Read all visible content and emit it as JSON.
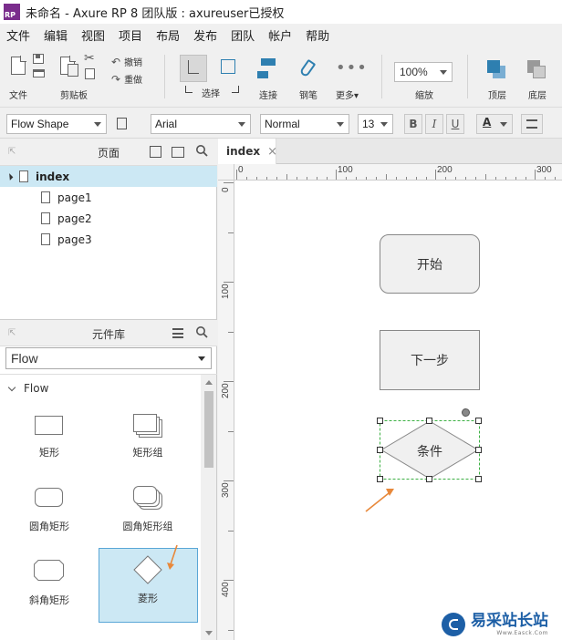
{
  "window": {
    "title": "未命名 - Axure RP 8 团队版 : axureuser已授权",
    "logo_text": "RP"
  },
  "menu": [
    "文件",
    "编辑",
    "视图",
    "项目",
    "布局",
    "发布",
    "团队",
    "帐户",
    "帮助"
  ],
  "toolbar": {
    "file_label": "文件",
    "clipboard_label": "剪贴板",
    "undo_label": "撤销",
    "redo_label": "重做",
    "select_label": "选择",
    "connect_label": "连接",
    "pen_label": "钢笔",
    "more_label": "更多▾",
    "zoom_value": "100%",
    "zoom_label": "缩放",
    "top_label": "顶层",
    "bottom_label": "底层"
  },
  "format_bar": {
    "style_value": "Flow Shape",
    "font_value": "Arial",
    "weight_value": "Normal",
    "size_value": "13",
    "bold": "B",
    "italic": "I",
    "underline": "U",
    "font_color": "A"
  },
  "pages_panel": {
    "title": "页面",
    "items": [
      {
        "label": "index",
        "selected": true
      },
      {
        "label": "page1"
      },
      {
        "label": "page2"
      },
      {
        "label": "page3"
      }
    ]
  },
  "library_panel": {
    "title": "元件库",
    "selected_library": "Flow",
    "section": "Flow",
    "items": [
      {
        "label": "矩形",
        "icon": "rectangle-icon"
      },
      {
        "label": "矩形组",
        "icon": "rectangle-group-icon"
      },
      {
        "label": "圆角矩形",
        "icon": "rounded-rectangle-icon"
      },
      {
        "label": "圆角矩形组",
        "icon": "rounded-rectangle-group-icon"
      },
      {
        "label": "斜角矩形",
        "icon": "bevel-rectangle-icon"
      },
      {
        "label": "菱形",
        "icon": "diamond-icon",
        "selected": true
      }
    ]
  },
  "canvas": {
    "tab": "index",
    "tab_close": "×",
    "ruler_h": [
      "0",
      "100",
      "200",
      "300"
    ],
    "ruler_v": [
      "0",
      "100",
      "200",
      "300",
      "400"
    ],
    "shapes": {
      "start": "开始",
      "next": "下一步",
      "condition": "条件"
    }
  },
  "watermark": {
    "text": "易采站长站",
    "sub": "Www.Easck.Com"
  },
  "colors": {
    "selection_bg": "#cce8f4",
    "selection_border": "#5aa6d6",
    "shape_fill": "#f0f0f0",
    "shape_border": "#888888",
    "arrow": "#e8883a",
    "select_outline": "#3cb043"
  }
}
